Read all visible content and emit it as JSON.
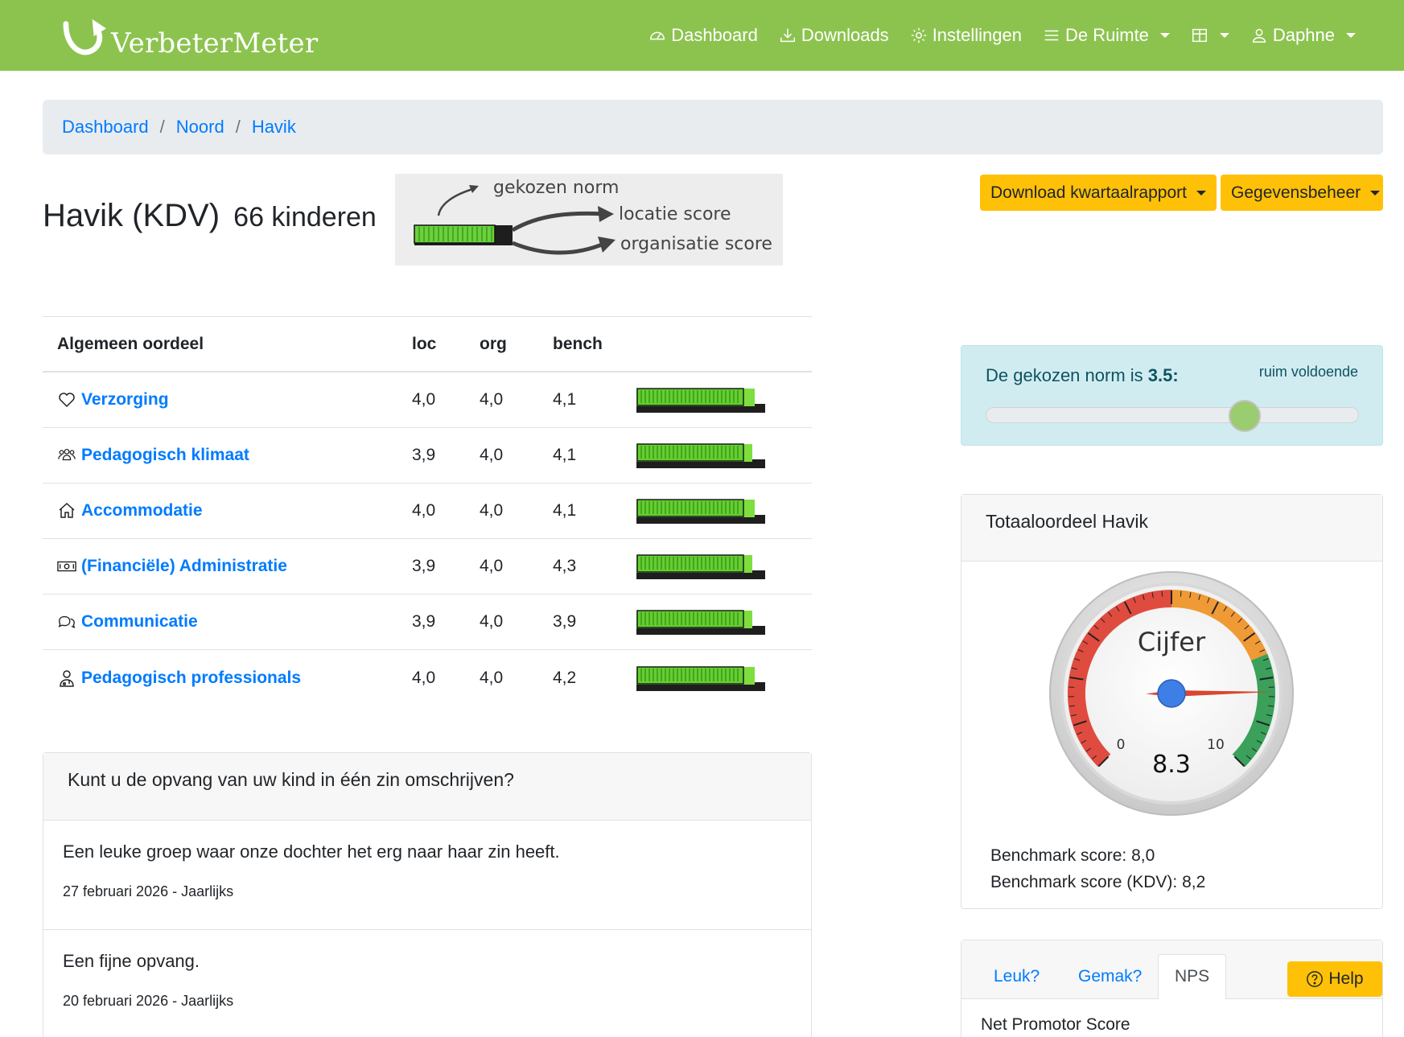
{
  "brand": {
    "name": "VerbeterMeter"
  },
  "nav": {
    "items": [
      {
        "label": "Dashboard",
        "icon": "speedometer-icon"
      },
      {
        "label": "Downloads",
        "icon": "download-icon"
      },
      {
        "label": "Instellingen",
        "icon": "gear-icon"
      },
      {
        "label": "De Ruimte",
        "icon": "list-icon"
      },
      {
        "label": "",
        "icon": "grid-icon"
      },
      {
        "label": "Daphne",
        "icon": "user-icon"
      }
    ]
  },
  "breadcrumb": [
    "Dashboard",
    "Noord",
    "Havik"
  ],
  "page": {
    "title": "Havik (KDV)",
    "subtitle": "66 kinderen"
  },
  "legend": {
    "norm": "gekozen norm",
    "location": "locatie score",
    "organisation": "organisatie score"
  },
  "actions": {
    "download": "Download kwartaalrapport",
    "manage": "Gegevensbeheer"
  },
  "table": {
    "headers": {
      "name": "Algemeen oordeel",
      "loc": "loc",
      "org": "org",
      "bench": "bench"
    },
    "rows": [
      {
        "name": "Verzorging",
        "icon": "heart-icon",
        "loc": "4,0",
        "org": "4,0",
        "bench": "4,1",
        "loc_v": 4.0,
        "org_v": 4.0
      },
      {
        "name": "Pedagogisch klimaat",
        "icon": "people-icon",
        "loc": "3,9",
        "org": "4,0",
        "bench": "4,1",
        "loc_v": 3.9,
        "org_v": 4.0
      },
      {
        "name": "Accommodatie",
        "icon": "house-icon",
        "loc": "4,0",
        "org": "4,0",
        "bench": "4,1",
        "loc_v": 4.0,
        "org_v": 4.0
      },
      {
        "name": "(Financiële) Administratie",
        "icon": "cash-icon",
        "loc": "3,9",
        "org": "4,0",
        "bench": "4,3",
        "loc_v": 3.9,
        "org_v": 4.0
      },
      {
        "name": "Communicatie",
        "icon": "chat-icon",
        "loc": "3,9",
        "org": "4,0",
        "bench": "3,9",
        "loc_v": 3.9,
        "org_v": 4.0
      },
      {
        "name": "Pedagogisch professionals",
        "icon": "professional-icon",
        "loc": "4,0",
        "org": "4,0",
        "bench": "4,2",
        "loc_v": 4.0,
        "org_v": 4.0
      }
    ],
    "norm": 3.5
  },
  "question": {
    "title": "Kunt u de opvang van uw kind in één zin omschrijven?",
    "answers": [
      {
        "text": "Een leuke groep waar onze dochter het erg naar haar zin heeft.",
        "meta": "27 februari 2026 - Jaarlijks"
      },
      {
        "text": "Een fijne opvang.",
        "meta": "20 februari 2026 - Jaarlijks"
      }
    ]
  },
  "norm": {
    "label": "De gekozen norm is",
    "value": "3.5:",
    "level": "ruim voldoende",
    "slider_fraction": 0.695
  },
  "total": {
    "title": "Totaaloordeel Havik",
    "gauge_label": "Cijfer",
    "min": "0",
    "max": "10",
    "value": "8.3",
    "value_num": 8.3,
    "bench1": "Benchmark score: 8,0",
    "bench2": "Benchmark score (KDV): 8,2"
  },
  "tabs": {
    "items": [
      "Leuk?",
      "Gemak?",
      "NPS"
    ],
    "active": 2,
    "body_title": "Net Promotor Score"
  },
  "help": {
    "label": "Help"
  },
  "colors": {
    "navbar": "#8cc34f",
    "link": "#007bff",
    "warning": "#ffc107",
    "gauge_red": "#e04b3f",
    "gauge_orange": "#ef9a35",
    "gauge_green": "#3aa05a"
  }
}
